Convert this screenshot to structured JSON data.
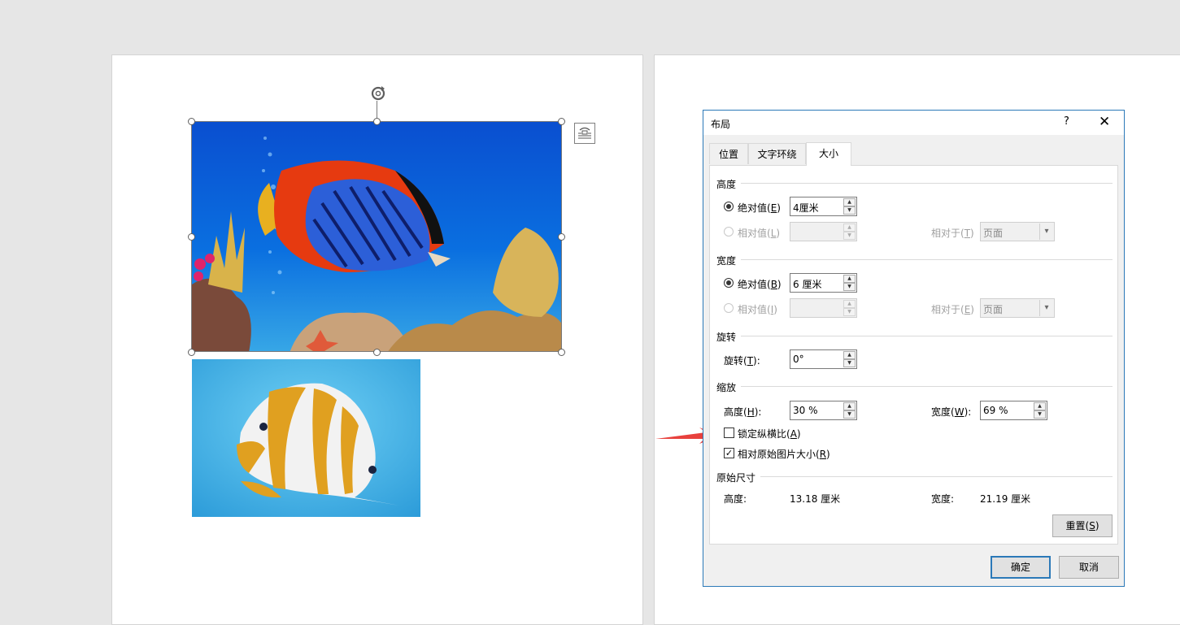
{
  "dialog": {
    "title": "布局",
    "help": "?",
    "close": "✕",
    "tabs": [
      {
        "label": "位置"
      },
      {
        "label": "文字环绕"
      },
      {
        "label": "大小"
      }
    ],
    "height_section": {
      "title": "高度",
      "absolute_label": "绝对值(",
      "absolute_key": "E",
      "absolute_value": "4厘米",
      "relative_label": "相对值(",
      "relative_key": "L",
      "relative_to_label": "相对于(",
      "relative_to_key": "T",
      "relative_to_value": "页面"
    },
    "width_section": {
      "title": "宽度",
      "absolute_label": "绝对值(",
      "absolute_key": "B",
      "absolute_value": "6 厘米",
      "relative_label": "相对值(",
      "relative_key": "I",
      "relative_to_label": "相对于(",
      "relative_to_key": "E",
      "relative_to_value": "页面"
    },
    "rotation_section": {
      "title": "旋转",
      "label": "旋转(",
      "key": "T",
      "value": "0°"
    },
    "scale_section": {
      "title": "缩放",
      "height_label": "高度(",
      "height_key": "H",
      "height_value": "30 %",
      "width_label": "宽度(",
      "width_key": "W",
      "width_value": "69 %",
      "lock_label": "锁定纵横比(",
      "lock_key": "A",
      "lock_checked": false,
      "relative_label": "相对原始图片大小(",
      "relative_key": "R",
      "relative_checked": true
    },
    "original_section": {
      "title": "原始尺寸",
      "height_label": "高度:",
      "height_value": "13.18 厘米",
      "width_label": "宽度:",
      "width_value": "21.19 厘米"
    },
    "reset_label": "重置(",
    "reset_key": "S",
    "ok_label": "确定",
    "cancel_label": "取消"
  },
  "colors": {
    "dialog_border": "#2b79b8",
    "arrow": "#e8413d",
    "water": "#0a6fd8"
  }
}
